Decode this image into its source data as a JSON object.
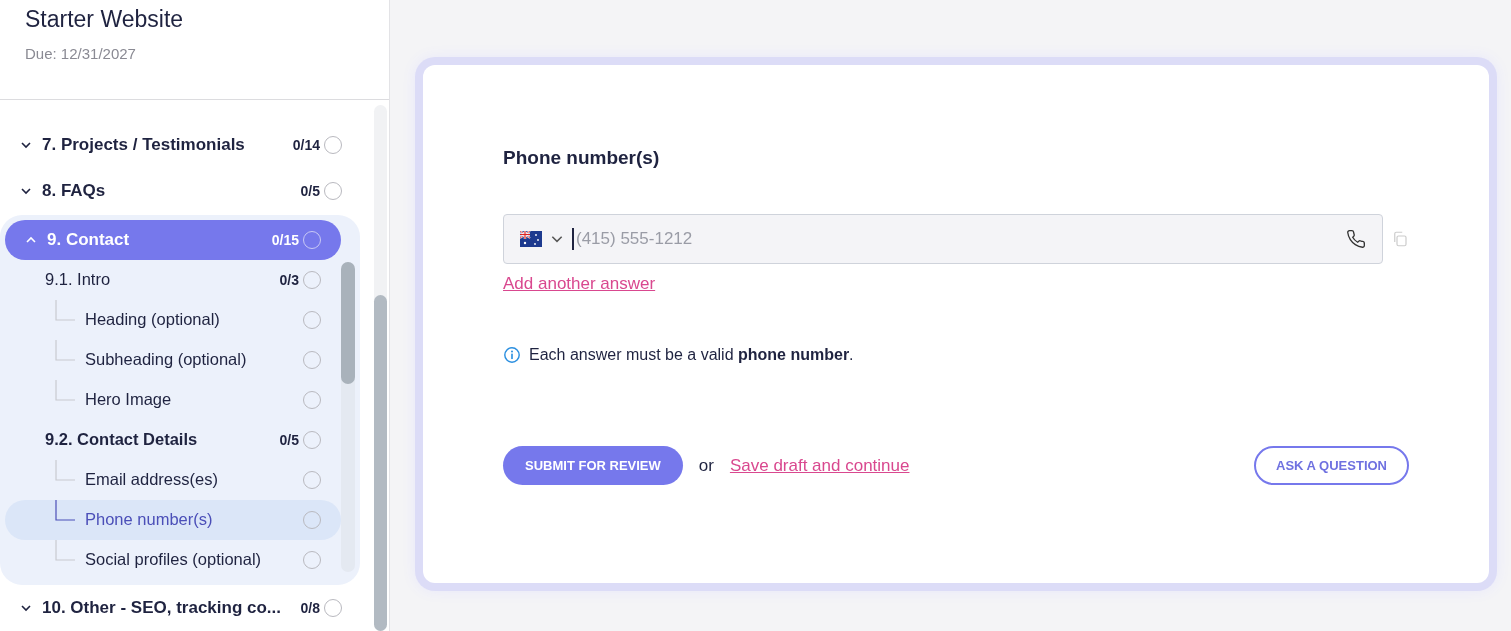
{
  "project": {
    "title": "Starter Website",
    "due": "Due: 12/31/2027"
  },
  "sections": [
    {
      "label": "7. Projects / Testimonials",
      "count": "0/14",
      "expanded": false,
      "selected": false,
      "done": false
    },
    {
      "label": "8. FAQs",
      "count": "0/5",
      "expanded": false,
      "selected": false,
      "done": false
    },
    {
      "label": "9. Contact",
      "count": "0/15",
      "expanded": true,
      "selected": true,
      "done": false,
      "children": [
        {
          "label": "9.1. Intro",
          "count": "0/3",
          "selected": false,
          "done": false,
          "children": [
            {
              "label": "Heading (optional)",
              "selected": false,
              "done": false
            },
            {
              "label": "Subheading (optional)",
              "selected": false,
              "done": false
            },
            {
              "label": "Hero Image",
              "selected": false,
              "done": false
            }
          ]
        },
        {
          "label": "9.2. Contact Details",
          "count": "0/5",
          "selected": false,
          "done": false,
          "children": [
            {
              "label": "Email address(es)",
              "selected": false,
              "done": false
            },
            {
              "label": "Phone number(s)",
              "selected": true,
              "done": false
            },
            {
              "label": "Social profiles (optional)",
              "selected": false,
              "done": false
            }
          ]
        }
      ]
    },
    {
      "label": "10. Other - SEO, tracking co...",
      "count": "0/8",
      "expanded": false,
      "selected": false,
      "done": false
    }
  ],
  "question": {
    "title": "Phone number(s)",
    "phone_field": {
      "placeholder": "(415) 555-1212"
    },
    "add_link": "Add another answer",
    "hint": "Each answer must be a valid **phone number**.",
    "submit": "SUBMIT FOR REVIEW",
    "or": "or",
    "save_link": "Save draft and continue",
    "ask": "ASK A QUESTION"
  }
}
